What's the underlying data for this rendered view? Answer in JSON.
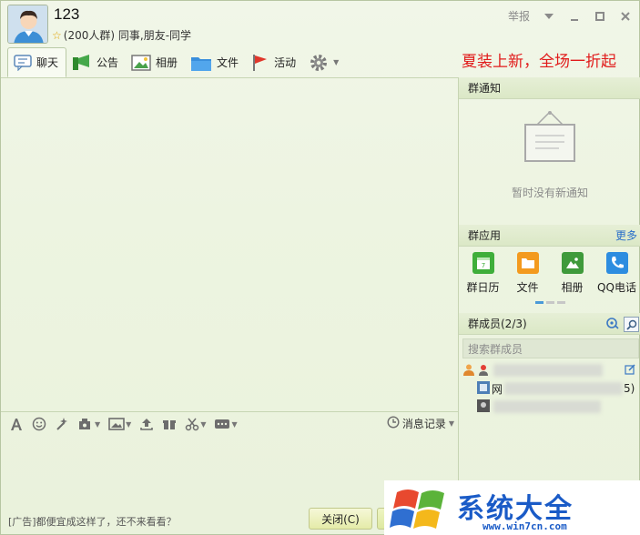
{
  "header": {
    "group_name": "123",
    "member_count": "(200人群)",
    "group_tags": "同事,朋友-同学",
    "report_label": "举报",
    "dropdown": "chevron-down-icon",
    "minimize": "minimize-icon",
    "maximize": "maximize-icon",
    "close": "close-icon"
  },
  "toolbar": {
    "tabs": [
      {
        "label": "聊天",
        "icon": "chat-icon",
        "active": true
      },
      {
        "label": "公告",
        "icon": "megaphone-icon"
      },
      {
        "label": "相册",
        "icon": "photo-icon"
      },
      {
        "label": "文件",
        "icon": "folder-icon"
      },
      {
        "label": "活动",
        "icon": "flag-icon"
      }
    ],
    "settings_icon": "gear-icon"
  },
  "ad_top": "夏装上新，全场一折起",
  "input_toolbar": {
    "icons": [
      "font-icon",
      "emoji-icon",
      "magic-icon",
      "vibrate-icon",
      "image-icon",
      "upload-icon",
      "gift-icon",
      "scissors-icon",
      "more-icon"
    ],
    "history_label": "消息记录"
  },
  "bottom": {
    "ad_text": "[广告]都便宜成这样了，还不来看看？",
    "close_label": "关闭(C)"
  },
  "notice": {
    "title": "群通知",
    "empty_text": "暂时没有新通知"
  },
  "apps": {
    "title": "群应用",
    "more_label": "更多",
    "items": [
      {
        "label": "群日历",
        "icon": "calendar-icon",
        "color": "#3fae3a"
      },
      {
        "label": "文件",
        "icon": "folder-icon",
        "color": "#f39a1e"
      },
      {
        "label": "相册",
        "icon": "photo-icon",
        "color": "#3f9a3b"
      },
      {
        "label": "QQ电话",
        "icon": "phone-icon",
        "color": "#2d8de0"
      }
    ]
  },
  "members": {
    "title": "群成员(2/3)",
    "search_placeholder": "搜索群成员",
    "rows": [
      {
        "name_prefix": "",
        "suffix": ""
      },
      {
        "name_prefix": "网",
        "suffix": "5)"
      },
      {
        "name_prefix": "",
        "suffix": ""
      }
    ]
  },
  "brand": {
    "text": "系统大全",
    "url": "www.win7cn.com"
  }
}
